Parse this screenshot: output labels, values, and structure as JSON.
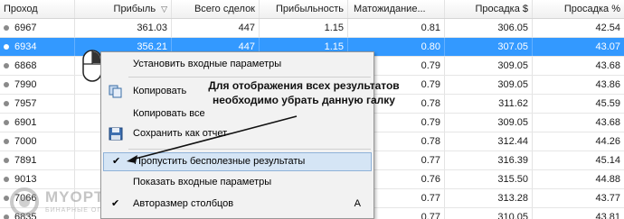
{
  "table": {
    "columns": [
      {
        "label": "Проход"
      },
      {
        "label": "Прибыль"
      },
      {
        "label": "Всего сделок"
      },
      {
        "label": "Прибыльность"
      },
      {
        "label": "Матожидание..."
      },
      {
        "label": "Просадка $"
      },
      {
        "label": "Просадка %"
      }
    ],
    "rows": [
      {
        "pass": "6967",
        "profit": "361.03",
        "trades": "447",
        "pf": "1.15",
        "exp": "0.81",
        "dd": "306.05",
        "ddp": "42.54"
      },
      {
        "pass": "6934",
        "profit": "356.21",
        "trades": "447",
        "pf": "1.15",
        "exp": "0.80",
        "dd": "307.05",
        "ddp": "43.07"
      },
      {
        "pass": "6868",
        "exp": "0.79",
        "dd": "309.05",
        "ddp": "43.68"
      },
      {
        "pass": "7990",
        "exp": "0.79",
        "dd": "309.05",
        "ddp": "43.86"
      },
      {
        "pass": "7957",
        "exp": "0.78",
        "dd": "311.62",
        "ddp": "45.59"
      },
      {
        "pass": "6901",
        "exp": "0.79",
        "dd": "309.05",
        "ddp": "43.68"
      },
      {
        "pass": "7000",
        "exp": "0.78",
        "dd": "312.44",
        "ddp": "44.26"
      },
      {
        "pass": "7891",
        "exp": "0.77",
        "dd": "316.39",
        "ddp": "45.14"
      },
      {
        "pass": "9013",
        "exp": "0.76",
        "dd": "315.50",
        "ddp": "44.88"
      },
      {
        "pass": "7066",
        "exp": "0.77",
        "dd": "313.28",
        "ddp": "43.77"
      },
      {
        "pass": "6835",
        "exp": "0.77",
        "dd": "310.05",
        "ddp": "43.81"
      }
    ]
  },
  "context_menu": {
    "items": [
      {
        "label": "Установить входные параметры"
      },
      {
        "label": "Копировать"
      },
      {
        "label": "Копировать все"
      },
      {
        "label": "Сохранить как отчет"
      },
      {
        "label": "Пропустить бесполезные результаты",
        "checked": true
      },
      {
        "label": "Показать входные параметры"
      },
      {
        "label": "Авторазмер столбцов",
        "checked": true,
        "shortcut": "A"
      }
    ]
  },
  "annotation": {
    "text": "Для отображения всех результатов необходимо убрать данную галку"
  },
  "watermark": {
    "brand": "MYOPTION",
    "tagline": "БИНАРНЫЕ ОПЦИОНЫ"
  },
  "colors": {
    "selection": "#3399ff",
    "menu_highlight": "#d5e5f5"
  }
}
